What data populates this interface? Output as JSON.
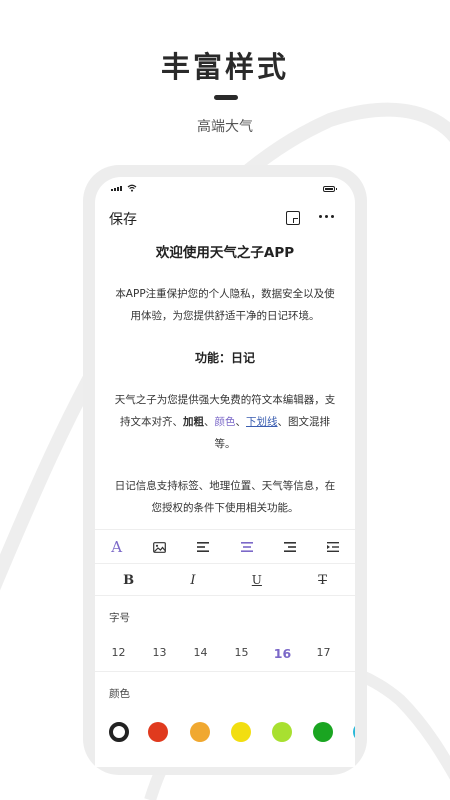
{
  "promo": {
    "title": "丰富样式",
    "subtitle": "高端大气"
  },
  "header": {
    "save_label": "保存"
  },
  "doc": {
    "title": "欢迎使用天气之子APP",
    "p1": "本APP注重保护您的个人隐私，数据安全以及使用体验，为您提供舒适干净的日记环境。",
    "heading": "功能：日记",
    "p2": {
      "before": "天气之子为您提供强大免费的符文本编辑器，支持文本对齐、",
      "bold": "加粗",
      "sep1": "、",
      "color": "颜色",
      "sep2": "、",
      "underline": "下划线",
      "after": "、图文混排等。"
    },
    "p3": "日记信息支持标签、地理位置、天气等信息，在您授权的条件下使用相关功能。"
  },
  "toolbar": {
    "font_glyph": "A",
    "icons": [
      "font-icon",
      "image-icon",
      "align-left-icon",
      "align-center-icon",
      "align-right-icon",
      "indent-icon"
    ]
  },
  "style_buttons": {
    "bold": "B",
    "italic": "I",
    "underline": "U",
    "strike": "T"
  },
  "font_size": {
    "label": "字号",
    "sizes": [
      "12",
      "13",
      "14",
      "15",
      "16",
      "17"
    ],
    "selected": "16"
  },
  "colors": {
    "label": "颜色",
    "swatches": [
      "#222222",
      "#e03a1e",
      "#f0a830",
      "#f2de10",
      "#a8e030",
      "#1aa521",
      "#2ab8d8"
    ],
    "selected_index": 0
  },
  "accent": "#7b68c8"
}
